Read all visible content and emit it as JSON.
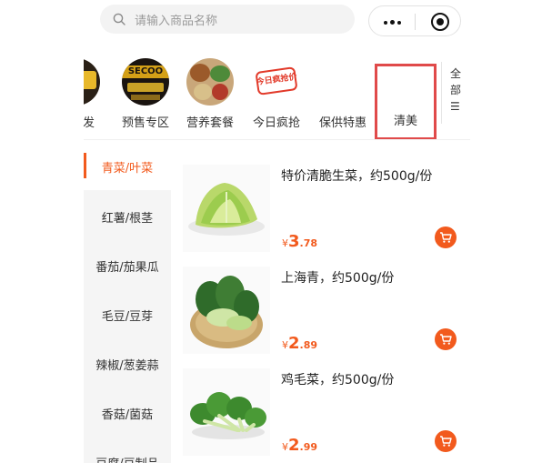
{
  "search": {
    "placeholder": "请输入商品名称"
  },
  "capsule": {
    "more_icon": "more-dots-icon",
    "close_icon": "target-icon"
  },
  "categories": [
    {
      "label": "发",
      "partial": true
    },
    {
      "label": "预售专区"
    },
    {
      "label": "营养套餐"
    },
    {
      "label": "今日疯抢"
    },
    {
      "label": "保供特惠"
    },
    {
      "label": "清美",
      "highlighted": true
    }
  ],
  "category_badges": {
    "presale": "SECOO",
    "today_sale": "今日疯抢价"
  },
  "more": {
    "chars": [
      "全",
      "部",
      "☰"
    ]
  },
  "sidebar": {
    "items": [
      {
        "label": "青菜/叶菜",
        "active": true
      },
      {
        "label": "红薯/根茎"
      },
      {
        "label": "番茄/茄果瓜"
      },
      {
        "label": "毛豆/豆芽"
      },
      {
        "label": "辣椒/葱姜蒜"
      },
      {
        "label": "香菇/菌菇"
      },
      {
        "label": "豆腐/豆制品"
      }
    ]
  },
  "products": [
    {
      "name": "特价清脆生菜，约500g/份",
      "currency": "¥",
      "price_int": "3",
      "price_dec": ".78"
    },
    {
      "name": "上海青，约500g/份",
      "currency": "¥",
      "price_int": "2",
      "price_dec": ".89"
    },
    {
      "name": "鸡毛菜，约500g/份",
      "currency": "¥",
      "price_int": "2",
      "price_dec": ".99"
    }
  ],
  "colors": {
    "accent": "#f25a1d",
    "highlight_box": "#e04a4a"
  }
}
